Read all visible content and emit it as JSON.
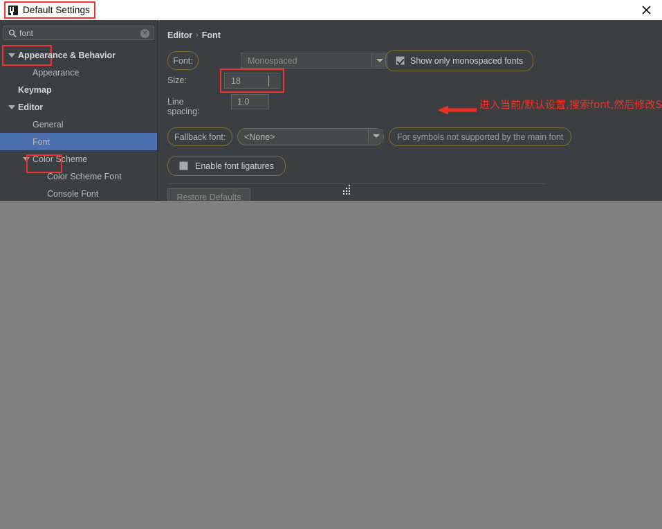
{
  "window": {
    "title": "Default Settings",
    "app_icon": "intellij-idea-icon",
    "close_label": "✕"
  },
  "sidebar": {
    "search": {
      "value": "font",
      "placeholder": "",
      "icon": "search-icon",
      "clear_icon": "clear-icon",
      "clear_glyph": "✕"
    },
    "items": [
      {
        "label": "Appearance & Behavior",
        "indent": 0,
        "bold": true,
        "expander": "expanded",
        "selected": false
      },
      {
        "label": "Appearance",
        "indent": 1,
        "bold": false,
        "expander": "none",
        "selected": false
      },
      {
        "label": "Keymap",
        "indent": 0,
        "bold": true,
        "expander": "none",
        "selected": false
      },
      {
        "label": "Editor",
        "indent": 0,
        "bold": true,
        "expander": "expanded",
        "selected": false
      },
      {
        "label": "General",
        "indent": 1,
        "bold": false,
        "expander": "none",
        "selected": false
      },
      {
        "label": "Font",
        "indent": 1,
        "bold": false,
        "expander": "none",
        "selected": true
      },
      {
        "label": "Color Scheme",
        "indent": 1,
        "bold": false,
        "expander": "expanded",
        "selected": false
      },
      {
        "label": "Color Scheme Font",
        "indent": 2,
        "bold": false,
        "expander": "none",
        "selected": false
      },
      {
        "label": "Console Font",
        "indent": 2,
        "bold": false,
        "expander": "none",
        "selected": false
      }
    ]
  },
  "main": {
    "breadcrumb": {
      "parent": "Editor",
      "separator": "›",
      "current": "Font"
    },
    "font_row": {
      "label": "Font:",
      "value": "Monospaced",
      "dropdown_icon": "chevron-down-icon",
      "checkbox_label": "Show only monospaced fonts",
      "checkbox_checked": true
    },
    "size_row": {
      "label": "Size:",
      "value": "18"
    },
    "line_spacing_row": {
      "label": "Line spacing:",
      "value": "1.0"
    },
    "fallback_row": {
      "label": "Fallback font:",
      "value": "<None>",
      "dropdown_icon": "chevron-down-icon",
      "hint": "For symbols not supported by the main font"
    },
    "ligatures_row": {
      "label": "Enable font ligatures",
      "checked": false
    },
    "restore_button": "Restore Defaults"
  },
  "annotation": {
    "text": "进入当前/默认设置,搜索font,然后修改Size字体大小。",
    "arrow_icon": "left-arrow-icon",
    "color": "#ef3124",
    "highlight_color": "#f0312d"
  },
  "colors": {
    "window_bg": "#3c3f41",
    "field_bg": "#45494a",
    "selection_blue": "#4b6eaf",
    "search_ring": "#7c6f2c",
    "annotation_red": "#f0312d",
    "desktop_gray": "#808080"
  }
}
